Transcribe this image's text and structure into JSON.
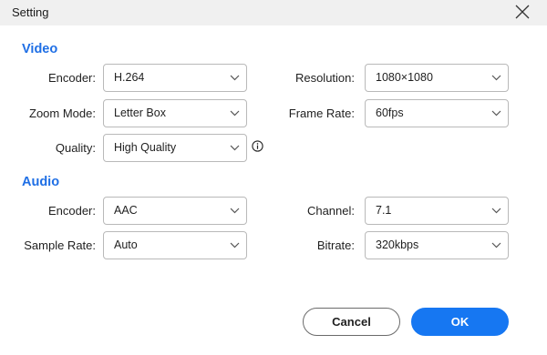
{
  "window": {
    "title": "Setting"
  },
  "video": {
    "heading": "Video",
    "encoder": {
      "label": "Encoder:",
      "value": "H.264"
    },
    "resolution": {
      "label": "Resolution:",
      "value": "1080×1080"
    },
    "zoom_mode": {
      "label": "Zoom Mode:",
      "value": "Letter Box"
    },
    "frame_rate": {
      "label": "Frame Rate:",
      "value": "60fps"
    },
    "quality": {
      "label": "Quality:",
      "value": "High Quality"
    }
  },
  "audio": {
    "heading": "Audio",
    "encoder": {
      "label": "Encoder:",
      "value": "AAC"
    },
    "channel": {
      "label": "Channel:",
      "value": "7.1"
    },
    "sample_rate": {
      "label": "Sample Rate:",
      "value": "Auto"
    },
    "bitrate": {
      "label": "Bitrate:",
      "value": "320kbps"
    }
  },
  "buttons": {
    "cancel": "Cancel",
    "ok": "OK"
  },
  "colors": {
    "accent": "#1f6fe5",
    "ok_button": "#1677f2",
    "titlebar": "#f0f0f0"
  },
  "icons": {
    "close": "close-icon",
    "chevron": "chevron-down-icon",
    "info": "info-icon"
  }
}
